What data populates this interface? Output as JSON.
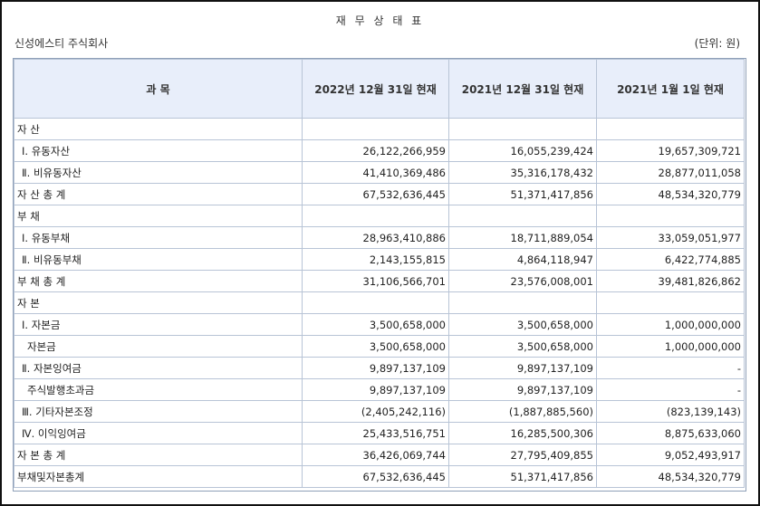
{
  "title": "재 무 상 태 표",
  "company": "신성에스티 주식회사",
  "unit": "(단위: 원)",
  "headers": [
    "과 목",
    "2022년 12월 31일 현재",
    "2021년 12월 31일 현재",
    "2021년   1월   1일 현재"
  ],
  "rows": [
    {
      "label": "자        산",
      "c1": "",
      "c2": "",
      "c3": "",
      "indent": ""
    },
    {
      "label": "Ⅰ. 유동자산",
      "c1": "26,122,266,959",
      "c2": "16,055,239,424",
      "c3": "19,657,309,721",
      "indent": "sub"
    },
    {
      "label": "Ⅱ. 비유동자산",
      "c1": "41,410,369,486",
      "c2": "35,316,178,432",
      "c3": "28,877,011,058",
      "indent": "sub"
    },
    {
      "label": "자 산 총 계",
      "c1": "67,532,636,445",
      "c2": "51,371,417,856",
      "c3": "48,534,320,779",
      "indent": ""
    },
    {
      "label": "부        채",
      "c1": "",
      "c2": "",
      "c3": "",
      "indent": ""
    },
    {
      "label": "Ⅰ. 유동부채",
      "c1": "28,963,410,886",
      "c2": "18,711,889,054",
      "c3": "33,059,051,977",
      "indent": "sub"
    },
    {
      "label": "Ⅱ. 비유동부채",
      "c1": "2,143,155,815",
      "c2": "4,864,118,947",
      "c3": "6,422,774,885",
      "indent": "sub"
    },
    {
      "label": "부 채 총 계",
      "c1": "31,106,566,701",
      "c2": "23,576,008,001",
      "c3": "39,481,826,862",
      "indent": ""
    },
    {
      "label": "자        본",
      "c1": "",
      "c2": "",
      "c3": "",
      "indent": ""
    },
    {
      "label": "Ⅰ. 자본금",
      "c1": "3,500,658,000",
      "c2": "3,500,658,000",
      "c3": "1,000,000,000",
      "indent": "sub"
    },
    {
      "label": "자본금",
      "c1": "3,500,658,000",
      "c2": "3,500,658,000",
      "c3": "1,000,000,000",
      "indent": "sub2"
    },
    {
      "label": "Ⅱ. 자본잉여금",
      "c1": "9,897,137,109",
      "c2": "9,897,137,109",
      "c3": "-",
      "indent": "sub"
    },
    {
      "label": "주식발행초과금",
      "c1": "9,897,137,109",
      "c2": "9,897,137,109",
      "c3": "-",
      "indent": "sub2"
    },
    {
      "label": "Ⅲ. 기타자본조정",
      "c1": "(2,405,242,116)",
      "c2": "(1,887,885,560)",
      "c3": "(823,139,143)",
      "indent": "sub"
    },
    {
      "label": "Ⅳ. 이익잉여금",
      "c1": "25,433,516,751",
      "c2": "16,285,500,306",
      "c3": "8,875,633,060",
      "indent": "sub"
    },
    {
      "label": "자 본 총 계",
      "c1": "36,426,069,744",
      "c2": "27,795,409,855",
      "c3": "9,052,493,917",
      "indent": ""
    },
    {
      "label": "부채및자본총계",
      "c1": "67,532,636,445",
      "c2": "51,371,417,856",
      "c3": "48,534,320,779",
      "indent": ""
    }
  ]
}
